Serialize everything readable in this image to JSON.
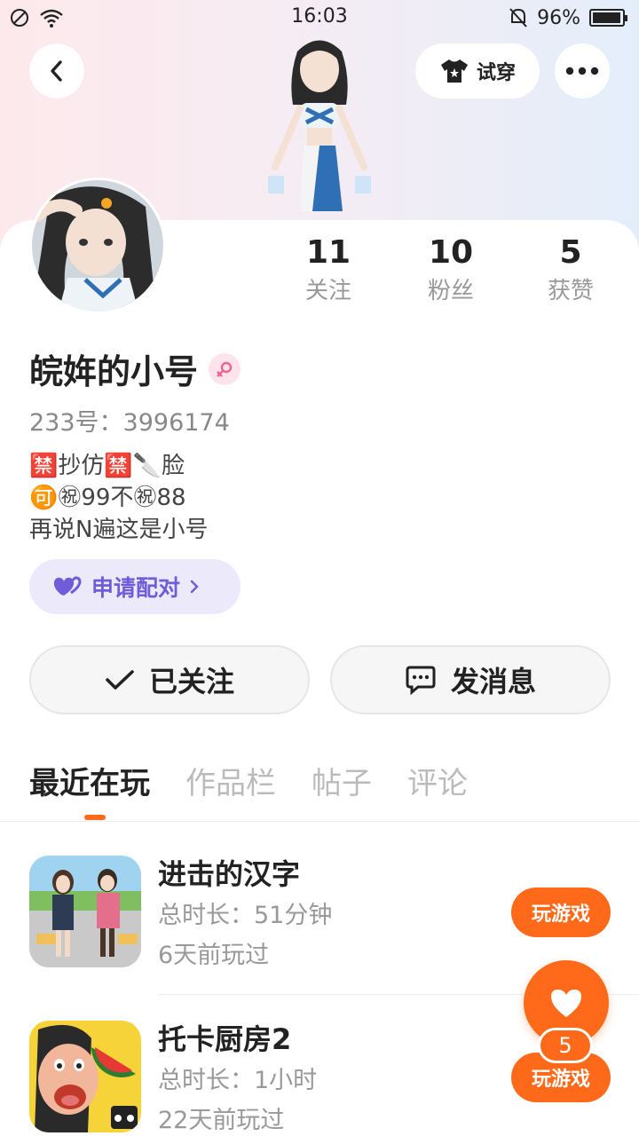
{
  "status_bar": {
    "time": "16:03",
    "battery": "96%"
  },
  "header": {
    "try_on_label": "试穿"
  },
  "profile": {
    "name": "皖姩的小号",
    "uid_label": "233号：3996174",
    "bio_lines": [
      "🈲抄仿🈲🔪脸",
      "🉑㊗99不㊗88",
      "再说N遍这是小号"
    ],
    "gender": "female"
  },
  "stats": [
    {
      "value": "11",
      "label": "关注"
    },
    {
      "value": "10",
      "label": "粉丝"
    },
    {
      "value": "5",
      "label": "获赞"
    }
  ],
  "pair_button": {
    "label": "申请配对"
  },
  "actions": {
    "follow_label": "已关注",
    "message_label": "发消息"
  },
  "tabs": [
    "最近在玩",
    "作品栏",
    "帖子",
    "评论"
  ],
  "games": [
    {
      "title": "进击的汉字",
      "duration": "总时长：51分钟",
      "last_played": "6天前玩过",
      "button": "玩游戏"
    },
    {
      "title": "托卡厨房2",
      "duration": "总时长：1小时",
      "last_played": "22天前玩过",
      "button": "玩游戏"
    }
  ],
  "like_fab": {
    "count": "5"
  },
  "colors": {
    "accent": "#ff6a1a",
    "pair_purple": "#6e5cd8"
  }
}
